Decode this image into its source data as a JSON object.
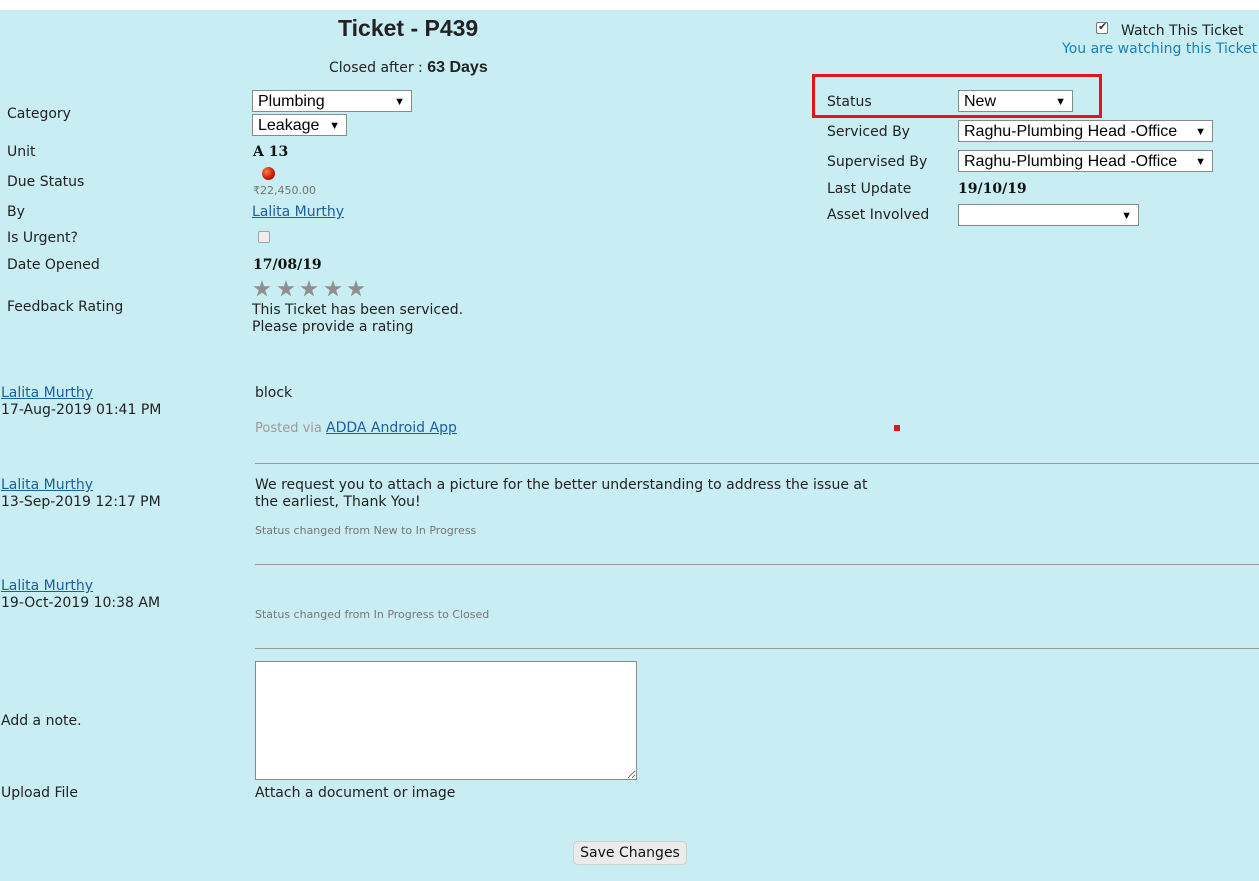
{
  "ticket": {
    "title": "Ticket - P439",
    "closed_after_label": "Closed after :",
    "closed_after_value": "63 Days",
    "watch_label": "Watch This Ticket",
    "watching_text": "You are watching this Ticket",
    "watch_checked": true
  },
  "left": {
    "category_label": "Category",
    "category_value": "Plumbing",
    "subcategory_value": "Leakage",
    "unit_label": "Unit",
    "unit_value": "A 13",
    "due_status_label": "Due Status",
    "due_amount": "₹22,450.00",
    "by_label": "By",
    "by_value": "Lalita Murthy",
    "urgent_label": "Is Urgent?",
    "urgent_checked": false,
    "date_opened_label": "Date Opened",
    "date_opened_value": "17/08/19",
    "feedback_label": "Feedback Rating",
    "feedback_stars": 5,
    "feedback_text_1": "This Ticket has been serviced.",
    "feedback_text_2": "Please provide a rating"
  },
  "right": {
    "status_label": "Status",
    "status_value": "New",
    "serviced_by_label": "Serviced By",
    "serviced_by_value": "Raghu-Plumbing Head -Office",
    "supervised_by_label": "Supervised By",
    "supervised_by_value": "Raghu-Plumbing Head -Office",
    "last_update_label": "Last Update",
    "last_update_value": "19/10/19",
    "asset_label": "Asset Involved",
    "asset_value": ""
  },
  "comments": [
    {
      "author": "Lalita Murthy",
      "time": "17-Aug-2019 01:41 PM",
      "text": "block",
      "posted_via_label": "Posted via",
      "posted_via_link": "ADDA Android App"
    },
    {
      "author": "Lalita Murthy",
      "time": "13-Sep-2019 12:17 PM",
      "text_1": "We request you to attach a picture for the better understanding to address the issue at",
      "text_2": "the earliest, Thank You!",
      "status_change": "Status changed from New to In Progress"
    },
    {
      "author": "Lalita Murthy",
      "time": "19-Oct-2019 10:38 AM",
      "status_change": "Status changed from In Progress to Closed"
    }
  ],
  "form": {
    "note_label": "Add a note.",
    "upload_label": "Upload File",
    "attach_text": "Attach a document or image",
    "save_label": "Save Changes"
  },
  "colors": {
    "background": "#c8edf2",
    "highlight_box": "#e4121b",
    "link": "#1b5f9e"
  }
}
